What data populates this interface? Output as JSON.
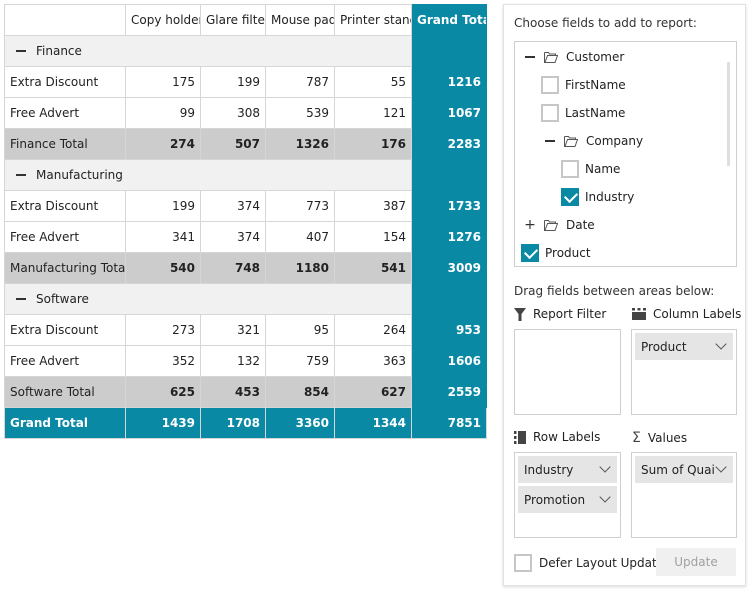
{
  "pivot": {
    "columns": [
      "",
      "Copy holder",
      "Glare filter",
      "Mouse pad",
      "Printer stand",
      "Grand Total"
    ],
    "groups": [
      {
        "name": "Finance",
        "rows": [
          {
            "label": "Extra Discount",
            "values": [
              "175",
              "199",
              "787",
              "55",
              "1216"
            ]
          },
          {
            "label": "Free Advert",
            "values": [
              "99",
              "308",
              "539",
              "121",
              "1067"
            ]
          }
        ],
        "total": {
          "label": "Finance Total",
          "values": [
            "274",
            "507",
            "1326",
            "176",
            "2283"
          ]
        }
      },
      {
        "name": "Manufacturing",
        "rows": [
          {
            "label": "Extra Discount",
            "values": [
              "199",
              "374",
              "773",
              "387",
              "1733"
            ]
          },
          {
            "label": "Free Advert",
            "values": [
              "341",
              "374",
              "407",
              "154",
              "1276"
            ]
          }
        ],
        "total": {
          "label": "Manufacturing Total",
          "values": [
            "540",
            "748",
            "1180",
            "541",
            "3009"
          ]
        }
      },
      {
        "name": "Software",
        "rows": [
          {
            "label": "Extra Discount",
            "values": [
              "273",
              "321",
              "95",
              "264",
              "953"
            ]
          },
          {
            "label": "Free Advert",
            "values": [
              "352",
              "132",
              "759",
              "363",
              "1606"
            ]
          }
        ],
        "total": {
          "label": "Software Total",
          "values": [
            "625",
            "453",
            "854",
            "627",
            "2559"
          ]
        }
      }
    ],
    "grand_total": {
      "label": "Grand Total",
      "values": [
        "1439",
        "1708",
        "3360",
        "1344",
        "7851"
      ]
    }
  },
  "field_list": {
    "title": "Choose fields to add to report:",
    "tree": [
      {
        "label": "Customer",
        "type": "folder",
        "expanded": true
      },
      {
        "label": "FirstName",
        "type": "field",
        "checked": false
      },
      {
        "label": "LastName",
        "type": "field",
        "checked": false
      },
      {
        "label": "Company",
        "type": "folder",
        "expanded": true
      },
      {
        "label": "Name",
        "type": "field",
        "checked": false
      },
      {
        "label": "Industry",
        "type": "field",
        "checked": true
      },
      {
        "label": "Date",
        "type": "folder",
        "expanded": false
      },
      {
        "label": "Product",
        "type": "field",
        "checked": true
      }
    ],
    "drag_title": "Drag fields between areas below:",
    "areas": {
      "report_filter": {
        "label": "Report Filter",
        "items": []
      },
      "column_labels": {
        "label": "Column Labels",
        "items": [
          "Product"
        ]
      },
      "row_labels": {
        "label": "Row Labels",
        "items": [
          "Industry",
          "Promotion"
        ]
      },
      "values": {
        "label": "Values",
        "items": [
          "Sum of Quantity"
        ]
      }
    },
    "values_item_visible": "Sum of Quai",
    "defer_label": "Defer Layout Update",
    "defer_checked": false,
    "update_label": "Update"
  },
  "colors": {
    "accent": "#0a89a5",
    "subtotal": "#cccccc",
    "group_bg": "#f1f1f1"
  }
}
